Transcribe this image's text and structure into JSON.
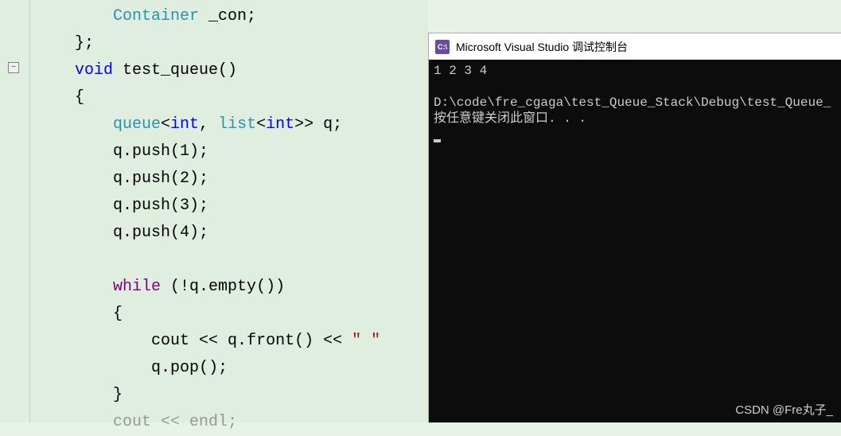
{
  "editor": {
    "fold_symbol": "−",
    "lines": {
      "l1_a": "Container",
      "l1_b": " _con;",
      "l2": "};",
      "l3_a": "void",
      "l3_b": " test_queue()",
      "l4": "{",
      "l5_a": "queue",
      "l5_b": "<",
      "l5_c": "int",
      "l5_d": ", ",
      "l5_e": "list",
      "l5_f": "<",
      "l5_g": "int",
      "l5_h": ">> q;",
      "l6_a": "q.",
      "l6_b": "push",
      "l6_c": "(1);",
      "l7_a": "q.",
      "l7_b": "push",
      "l7_c": "(2);",
      "l8_a": "q.",
      "l8_b": "push",
      "l8_c": "(3);",
      "l9_a": "q.",
      "l9_b": "push",
      "l9_c": "(4);",
      "l11_a": "while",
      "l11_b": " (!q.",
      "l11_c": "empty",
      "l11_d": "())",
      "l12": "{",
      "l13_a": "cout",
      "l13_b": " << q.",
      "l13_c": "front",
      "l13_d": "() << ",
      "l13_e": "\" \"",
      "l14_a": "q.",
      "l14_b": "pop",
      "l14_c": "();",
      "l15": "}",
      "l16_a": "cout",
      "l16_b": " << ",
      "l16_c": "endl",
      "l16_d": ";"
    }
  },
  "console": {
    "icon_text": "C:\\",
    "title": "Microsoft Visual Studio 调试控制台",
    "output_line1": "1 2 3 4",
    "output_line3": "D:\\code\\fre_cgaga\\test_Queue_Stack\\Debug\\test_Queue_",
    "output_line4": "按任意键关闭此窗口. . ."
  },
  "watermark": "CSDN @Fre丸子_"
}
